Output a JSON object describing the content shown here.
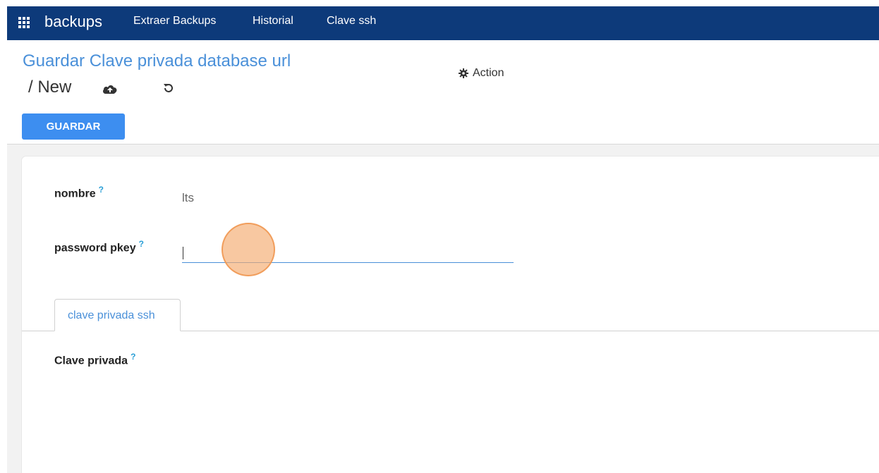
{
  "navbar": {
    "apps_icon": "grid-icon",
    "brand": "backups",
    "links": [
      "Extraer Backups",
      "Historial",
      "Clave ssh"
    ]
  },
  "header": {
    "title": "Guardar Clave privada database url",
    "breadcrumb": "/ New",
    "cloud_icon": "cloud-upload-icon",
    "undo_icon": "undo-icon",
    "action_label": "Action",
    "action_icon": "gear-icon"
  },
  "toolbar": {
    "save_label": "GUARDAR"
  },
  "form": {
    "fields": [
      {
        "label": "nombre",
        "help": "?",
        "value": "lts"
      },
      {
        "label": "password pkey",
        "help": "?",
        "value": ""
      }
    ],
    "tabs": [
      {
        "label": "clave privada ssh"
      }
    ],
    "tab_field": {
      "label": "Clave privada",
      "help": "?"
    }
  },
  "colors": {
    "navbar": "#0d3a7a",
    "accent": "#4a90d9",
    "button": "#3d8ef0",
    "click_marker": "#f5aa6e"
  }
}
